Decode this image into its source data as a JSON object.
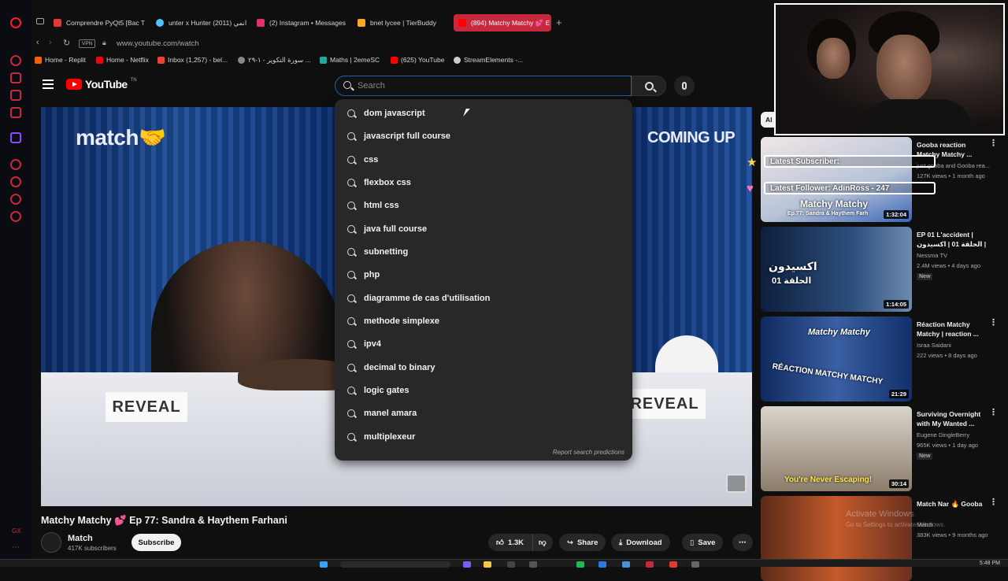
{
  "browser": {
    "tabs": [
      {
        "label": "Comprendre PyQt5 [Bac T",
        "color": "#e53935"
      },
      {
        "label": "unter x Hunter (2011) انمي",
        "color": "#4fc3f7"
      },
      {
        "label": "(2) Instagram • Messages",
        "color": "#e1306c"
      },
      {
        "label": "bnet lycee | TierBuddy",
        "color": "#f9a825"
      },
      {
        "label": "(894) Matchy Matchy 💕 E",
        "color": "#ff0000"
      }
    ],
    "new_tab": "+",
    "url": "www.youtube.com/watch",
    "vpn": "VPN",
    "bookmarks": [
      {
        "label": "Home - Replit",
        "color": "#f26207"
      },
      {
        "label": "Home - Netflix",
        "color": "#e50914"
      },
      {
        "label": "Inbox (1,257) - bel...",
        "color": "#ea4335"
      },
      {
        "label": "سورة التكوير - ١-٢٩ ...",
        "color": "#888888"
      },
      {
        "label": "Maths | 2emeSC",
        "color": "#26a69a"
      },
      {
        "label": "(625) YouTube",
        "color": "#ff0000"
      },
      {
        "label": "StreamElements -...",
        "color": "#cccccc"
      }
    ]
  },
  "youtube": {
    "logo_word": "YouTube",
    "logo_sup": "TN",
    "search_placeholder": "Search",
    "suggestions": [
      "dom javascript",
      "javascript full course",
      "css",
      "flexbox css",
      "html css",
      "java full course",
      "subnetting",
      "php",
      "diagramme de cas d'utilisation",
      "methode simplexe",
      "ipv4",
      "decimal to binary",
      "logic gates",
      "manel amara",
      "multiplexeur"
    ],
    "report_link": "Report search predictions"
  },
  "video": {
    "brand_text": "match🤝",
    "coming_up": "COMING UP",
    "reveal_left": "REVEAL",
    "reveal_right": "REVEAL",
    "title": "Matchy Matchy 💕 Ep 77: Sandra & Haythem Farhani",
    "channel": "Match",
    "subscribers": "417K subscribers",
    "subscribe": "Subscribe",
    "likes": "1.3K",
    "share": "Share",
    "download": "Download",
    "save": "Save"
  },
  "sidebar": {
    "filter_chip": "Al",
    "items": [
      {
        "title": "Gooba reaction Matchy Matchy ...",
        "channel": "just gooba and Gooba rea...",
        "meta": "127K views • 1 month ago",
        "duration": "1:32:04",
        "badge": "",
        "thumb_text": "Matchy Matchy",
        "thumb_sub": "Ep.77: Sandra & Haythem Farh"
      },
      {
        "title": "EP 01 L'accident | الحلقة 01 | اكسيدون |",
        "channel": "Nessma TV",
        "meta": "2.4M views • 4 days ago",
        "duration": "1:14:05",
        "badge": "New",
        "thumb_text": "اكسيدون",
        "thumb_sub": "الحلقة 01"
      },
      {
        "title": "Réaction Matchy Matchy | reaction ...",
        "channel": "Israa Saidani",
        "meta": "222 views • 8 days ago",
        "duration": "21:29",
        "badge": "",
        "thumb_text": "RÉACTION MATCHY MATCHY",
        "thumb_sub": "Matchy Matchy"
      },
      {
        "title": "Surviving Overnight with My Wanted ...",
        "channel": "Eugene DingleBerry",
        "meta": "965K views • 1 day ago",
        "duration": "30:14",
        "badge": "New",
        "thumb_text": "You're Never Escaping!",
        "thumb_sub": ""
      },
      {
        "title": "Match Nar 🔥 Gooba",
        "channel": "Match",
        "meta": "383K views • 9 months ago",
        "duration": "",
        "badge": "",
        "thumb_text": "",
        "thumb_sub": ""
      }
    ]
  },
  "stream": {
    "latest_subscriber": "Latest Subscriber:",
    "latest_follower": "Latest Follower: AdinRoss - 247",
    "watermark_line1": "Activate Windows",
    "watermark_line2": "Go to Settings to activate Windows."
  },
  "taskbar": {
    "clock": "5:48 PM"
  },
  "colors": {
    "accent": "#c6283e",
    "youtube_red": "#ff0000",
    "search_focus": "#1c62b9"
  }
}
